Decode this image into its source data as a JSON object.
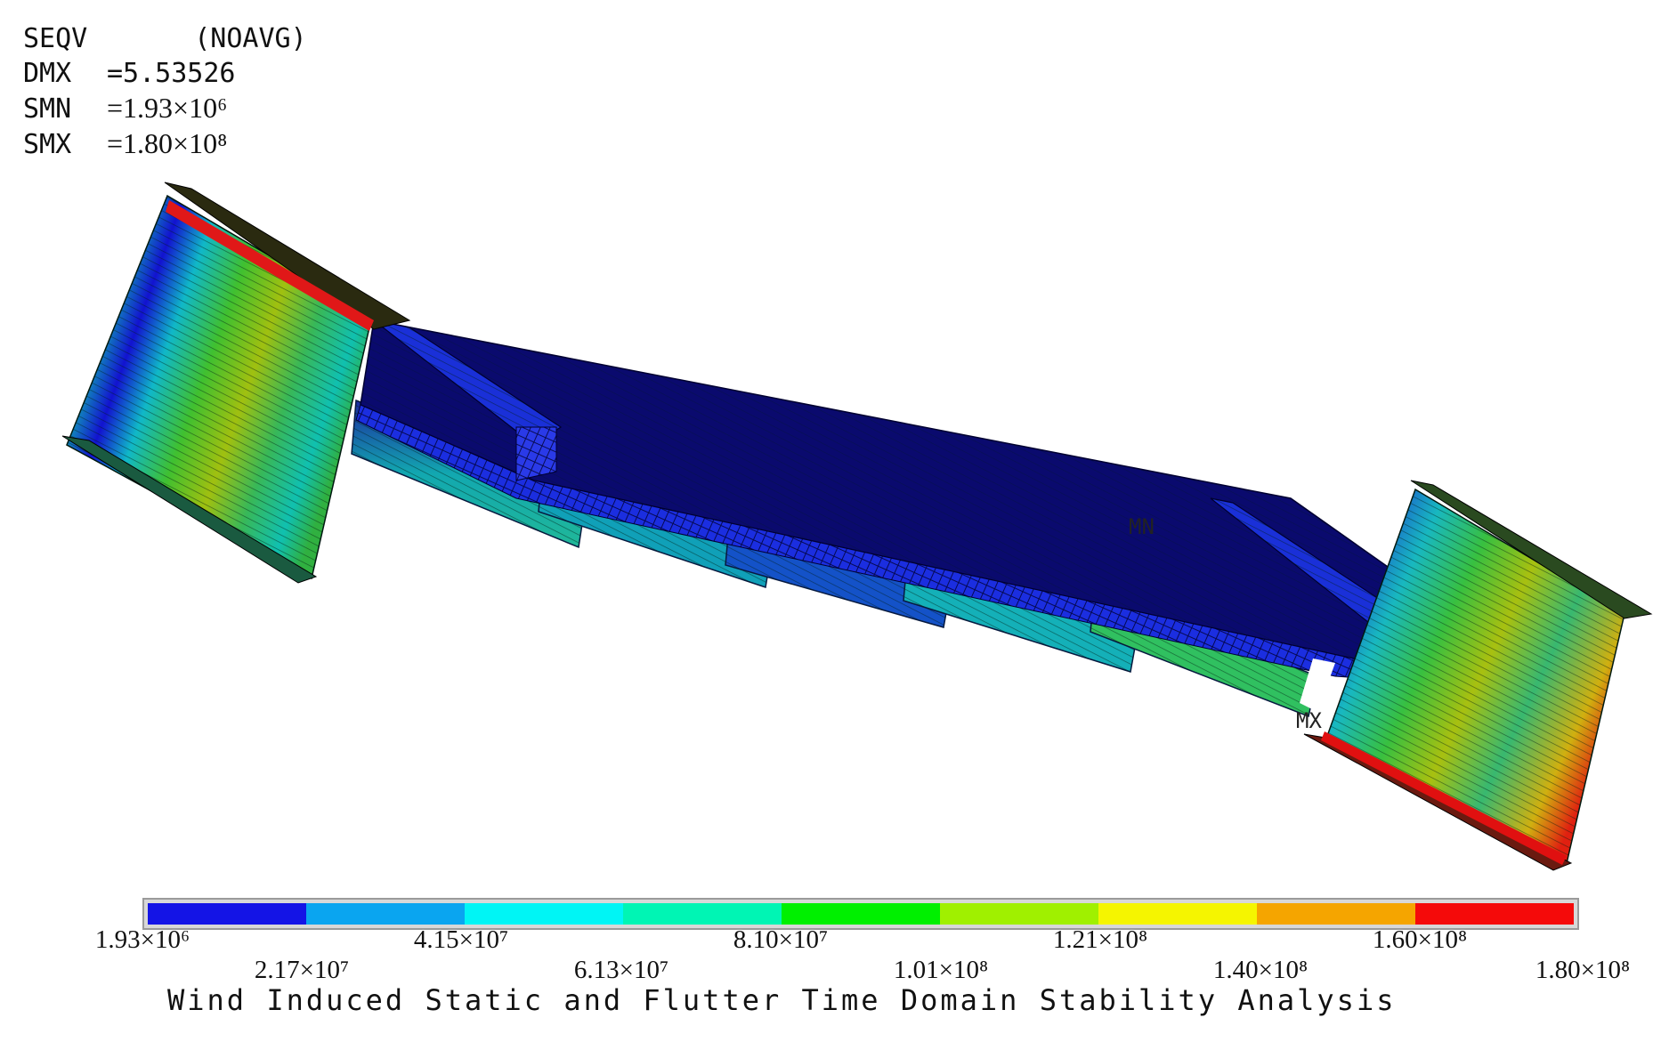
{
  "header": {
    "result_label": "SEQV",
    "averaging": "(NOAVG)",
    "dmx_label": "DMX",
    "dmx_value": "=5.53526",
    "smn_label": "SMN",
    "smn_value": "=1.93×10⁶",
    "smx_label": "SMX",
    "smx_value": "=1.80×10⁸"
  },
  "markers": {
    "min_label": "MN",
    "max_label": "MX"
  },
  "legend": {
    "colors": [
      "#1414e6",
      "#0aa5f0",
      "#00f5f5",
      "#00f5b4",
      "#00f000",
      "#a0f000",
      "#f5f500",
      "#f5a500",
      "#f50a0a"
    ],
    "row1": [
      "1.93×10⁶",
      "4.15×10⁷",
      "8.10×10⁷",
      "1.21×10⁸",
      "1.60×10⁸"
    ],
    "row2": [
      "2.17×10⁷",
      "6.13×10⁷",
      "1.01×10⁸",
      "1.40×10⁸",
      "1.80×10⁸"
    ]
  },
  "footer": {
    "title": "Wind Induced Static and Flutter Time Domain Stability Analysis"
  }
}
